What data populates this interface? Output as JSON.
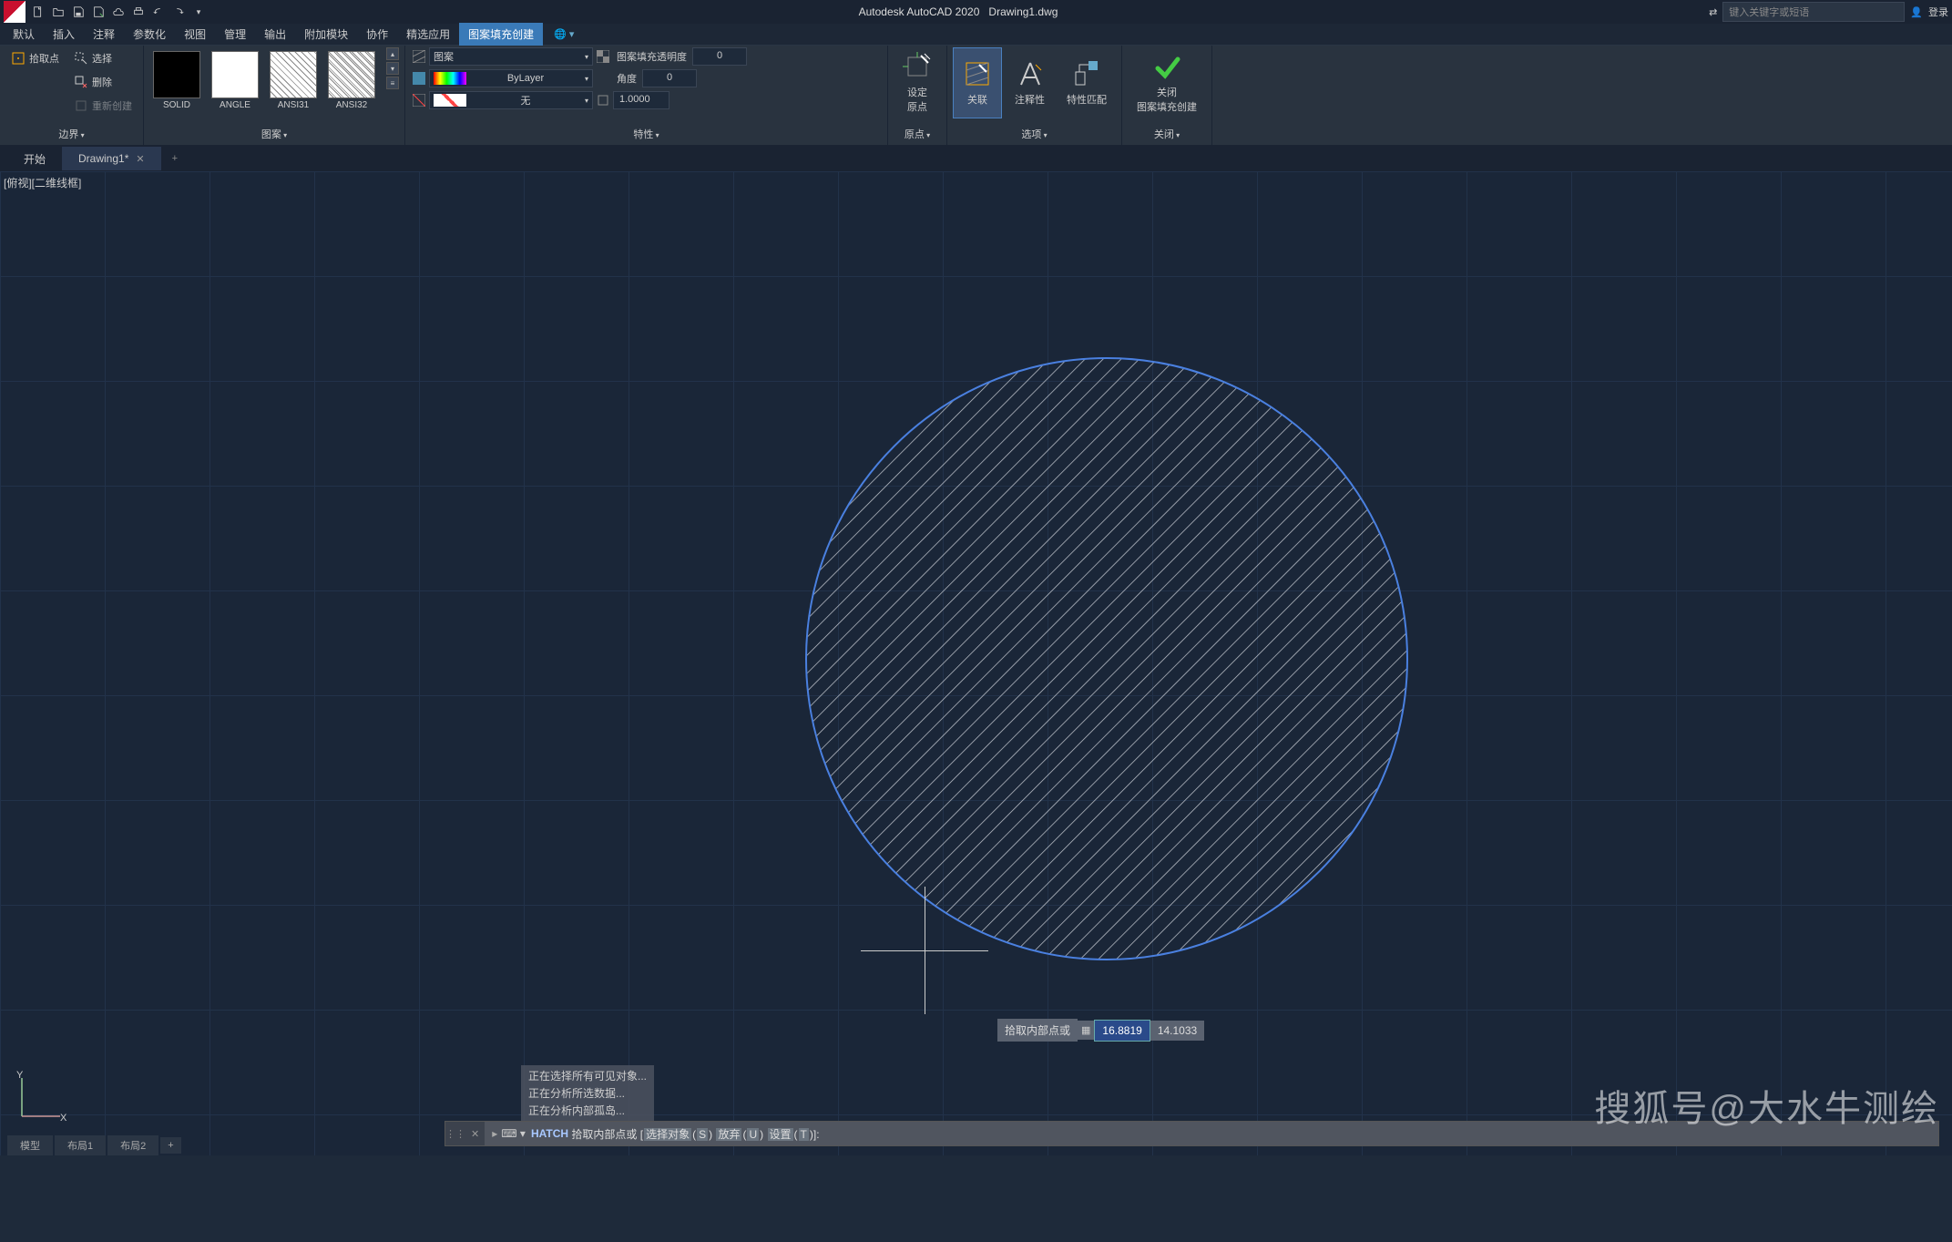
{
  "titlebar": {
    "app_name": "Autodesk AutoCAD 2020",
    "doc_name": "Drawing1.dwg",
    "search_placeholder": "键入关键字或短语",
    "login_label": "登录"
  },
  "menu_tabs": [
    "默认",
    "插入",
    "注释",
    "参数化",
    "视图",
    "管理",
    "输出",
    "附加模块",
    "协作",
    "精选应用",
    "图案填充创建"
  ],
  "menu_active_index": 10,
  "ribbon": {
    "boundary": {
      "select": "选择",
      "pick_points": "拾取点",
      "remove": "删除",
      "recreate": "重新创建",
      "panel": "边界"
    },
    "pattern": {
      "panel": "图案",
      "swatches": [
        "SOLID",
        "ANGLE",
        "ANSI31",
        "ANSI32"
      ]
    },
    "props": {
      "panel": "特性",
      "row1_left": "图案",
      "row1_label": "图案填充透明度",
      "row1_val": "0",
      "row2_left": "ByLayer",
      "row2_label": "角度",
      "row2_val": "0",
      "row3_left": "无",
      "row3_val": "1.0000"
    },
    "origin": {
      "label": "设定\n原点",
      "panel": "原点"
    },
    "options": {
      "assoc": "关联",
      "annot": "注释性",
      "match": "特性匹配",
      "panel": "选项"
    },
    "close": {
      "label": "关闭\n图案填充创建",
      "panel": "关闭"
    }
  },
  "doc_tabs": {
    "start": "开始",
    "active": "Drawing1*"
  },
  "viewport_label": "[俯视][二维线框]",
  "cursor_tip": {
    "label": "拾取内部点或",
    "c1": "16.8819",
    "c2": "14.1033"
  },
  "cmd_history": [
    "正在选择所有可见对象...",
    "正在分析所选数据...",
    "正在分析内部孤岛..."
  ],
  "cmd_line": {
    "cmd": "HATCH",
    "prompt": "拾取内部点或",
    "opt1_label": "选择对象",
    "opt1_key": "S",
    "opt2_label": "放弃",
    "opt2_key": "U",
    "opt3_label": "设置",
    "opt3_key": "T"
  },
  "status_tabs": [
    "模型",
    "布局1",
    "布局2"
  ],
  "watermark": "搜狐号@大水牛测绘",
  "ucs": {
    "y": "Y",
    "x": "X"
  }
}
